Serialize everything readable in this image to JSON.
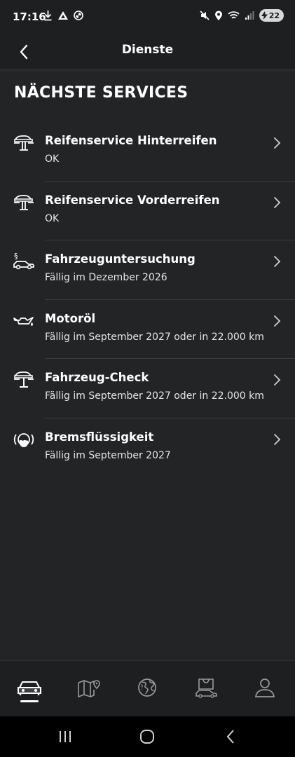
{
  "status_bar": {
    "time": "17:16",
    "battery": "22",
    "left_icons": [
      "download-icon",
      "navigation-icon",
      "bmw-logo-icon"
    ],
    "right_icons": [
      "mute-icon",
      "location-icon",
      "wifi-icon",
      "signal-icon",
      "battery-icon"
    ]
  },
  "header": {
    "title": "Dienste",
    "back_icon": "chevron-left-icon"
  },
  "section": {
    "title": "NÄCHSTE SERVICES"
  },
  "services": [
    {
      "title": "Reifenservice Hinterreifen",
      "status": "OK",
      "icon": "lift-icon"
    },
    {
      "title": "Reifenservice Vorderreifen",
      "status": "OK",
      "icon": "lift-icon"
    },
    {
      "title": "Fahrzeuguntersuchung",
      "status": "Fällig im Dezember 2026",
      "icon": "inspection-car-icon"
    },
    {
      "title": "Motoröl",
      "status": "Fällig im September 2027 oder in 22.000 km",
      "icon": "oil-can-icon"
    },
    {
      "title": "Fahrzeug-Check",
      "status": "Fällig im September 2027 oder in 22.000 km",
      "icon": "vehicle-check-icon"
    },
    {
      "title": "Bremsflüssigkeit",
      "status": "Fällig im September 2027",
      "icon": "brake-fluid-icon"
    }
  ],
  "bottom_nav": {
    "items": [
      "car-icon",
      "map-icon",
      "globe-icon",
      "shop-icon",
      "profile-icon"
    ],
    "active_index": 0
  },
  "system_nav": [
    "recents-icon",
    "home-icon",
    "back-icon"
  ],
  "colors": {
    "background": "#232426",
    "bar": "#1e1f21",
    "text": "#ffffff",
    "separator": "#3a3b3e"
  }
}
